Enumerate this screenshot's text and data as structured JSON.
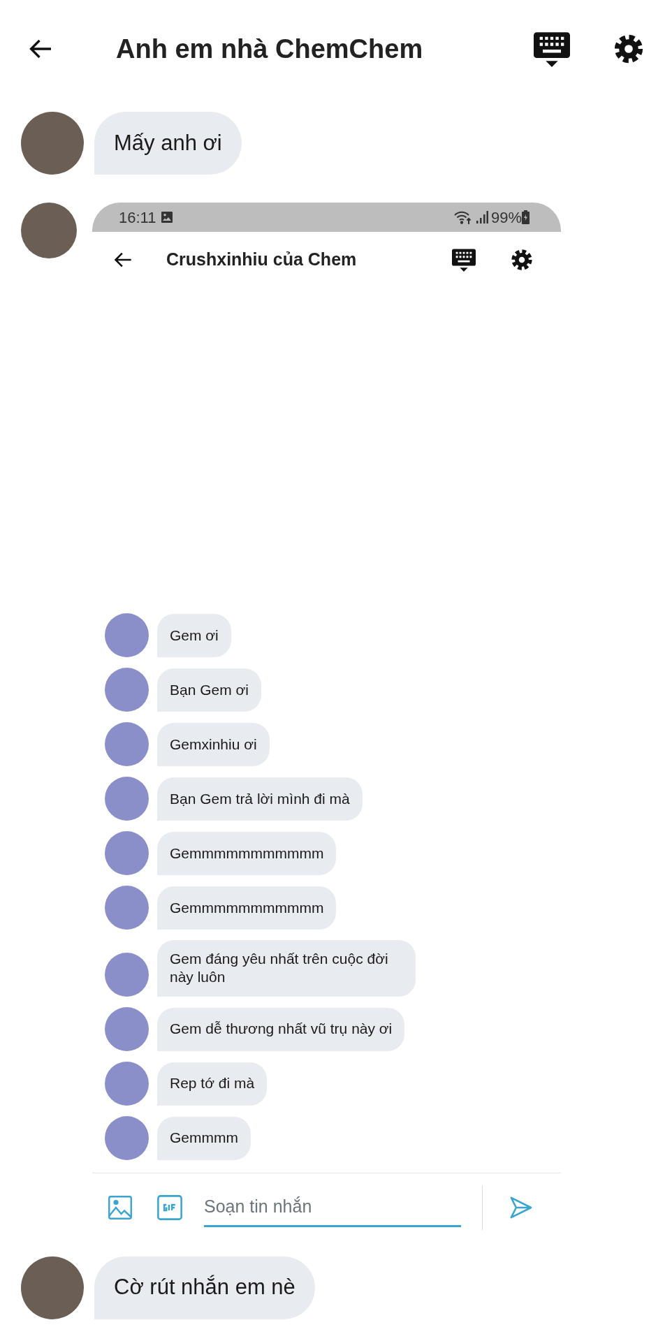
{
  "header": {
    "title": "Anh em nhà ChemChem"
  },
  "messages": [
    {
      "kind": "text",
      "text": "Mấy anh ơi"
    },
    {
      "kind": "screenshot",
      "screenshot": {
        "status_bar": {
          "time": "16:11",
          "battery": "99%"
        },
        "header": {
          "title": "Crushxinhiu của Chem"
        },
        "messages": [
          "Gem ơi",
          "Bạn Gem ơi",
          "Gemxinhiu ơi",
          "Bạn Gem trả lời mình đi mà",
          "Gemmmmmmmmmmm",
          "Gemmmmmmmmmmm",
          "Gem đáng yêu nhất trên cuộc đời này luôn",
          "Gem dễ thương nhất vũ trụ này ơi",
          "Rep tớ đi mà",
          "Gemmmm"
        ],
        "composer": {
          "placeholder": "Soạn tin nhắn"
        }
      }
    },
    {
      "kind": "text",
      "text": "Cờ rút nhắn em nè"
    }
  ]
}
